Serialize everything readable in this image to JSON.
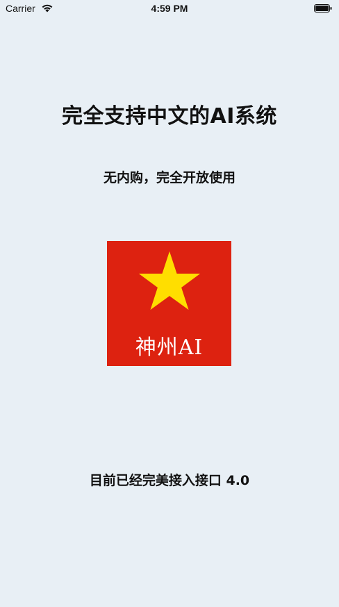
{
  "status_bar": {
    "carrier": "Carrier",
    "time": "4:59 PM"
  },
  "main": {
    "title": "完全支持中文的AI系统",
    "subtitle": "无内购，完全开放使用",
    "logo": {
      "text": "神州AI",
      "background_color": "#DD2210",
      "star_color": "#FFDE00",
      "icon": "star-icon"
    },
    "footer_text": "目前已经完美接入接口 4.0"
  }
}
